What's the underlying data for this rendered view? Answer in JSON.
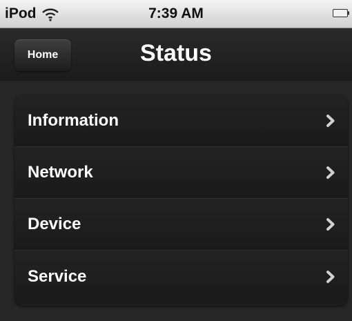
{
  "status_bar": {
    "carrier": "iPod",
    "time": "7:39 AM",
    "icons": [
      "wifi-icon",
      "battery-icon"
    ]
  },
  "nav_bar": {
    "back_label": "Home",
    "title": "Status"
  },
  "menu": {
    "items": [
      {
        "label": "Information",
        "icon": "chevron-right-icon"
      },
      {
        "label": "Network",
        "icon": "chevron-right-icon"
      },
      {
        "label": "Device",
        "icon": "chevron-right-icon"
      },
      {
        "label": "Service",
        "icon": "chevron-right-icon"
      }
    ]
  },
  "colors": {
    "status_bar_bg": "#dcdcdc",
    "nav_bar_bg": "#222222",
    "content_bg": "#262626",
    "text": "#ffffff"
  }
}
